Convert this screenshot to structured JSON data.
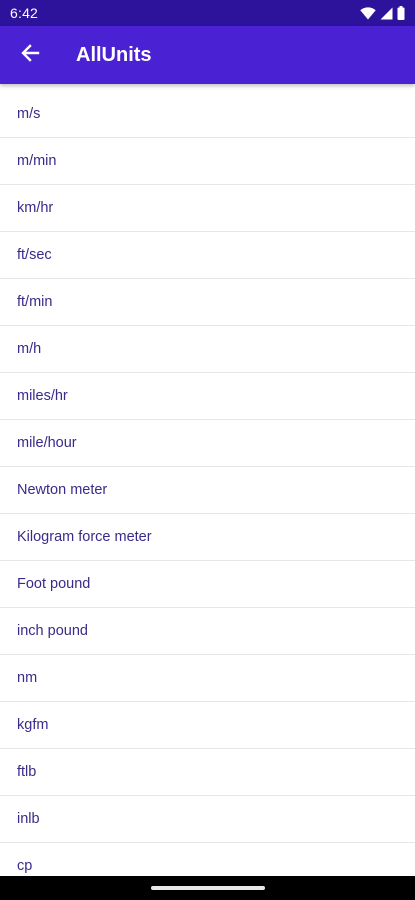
{
  "status_bar": {
    "time": "6:42",
    "icons": [
      "wifi-icon",
      "cellular-signal-icon",
      "battery-icon"
    ]
  },
  "app_bar": {
    "title": "AllUnits",
    "back_icon": "arrow-back-icon"
  },
  "units": [
    "m/s",
    "m/min",
    "km/hr",
    "ft/sec",
    "ft/min",
    "m/h",
    "miles/hr",
    "mile/hour",
    "Newton meter",
    "Kilogram force meter",
    "Foot pound",
    "inch pound",
    "nm",
    "kgfm",
    "ftlb",
    "inlb",
    "cp"
  ],
  "colors": {
    "status_bar": "#2d139c",
    "app_bar": "#4a22d4",
    "list_text": "#3a2a8a",
    "divider": "#e6e6e6"
  }
}
